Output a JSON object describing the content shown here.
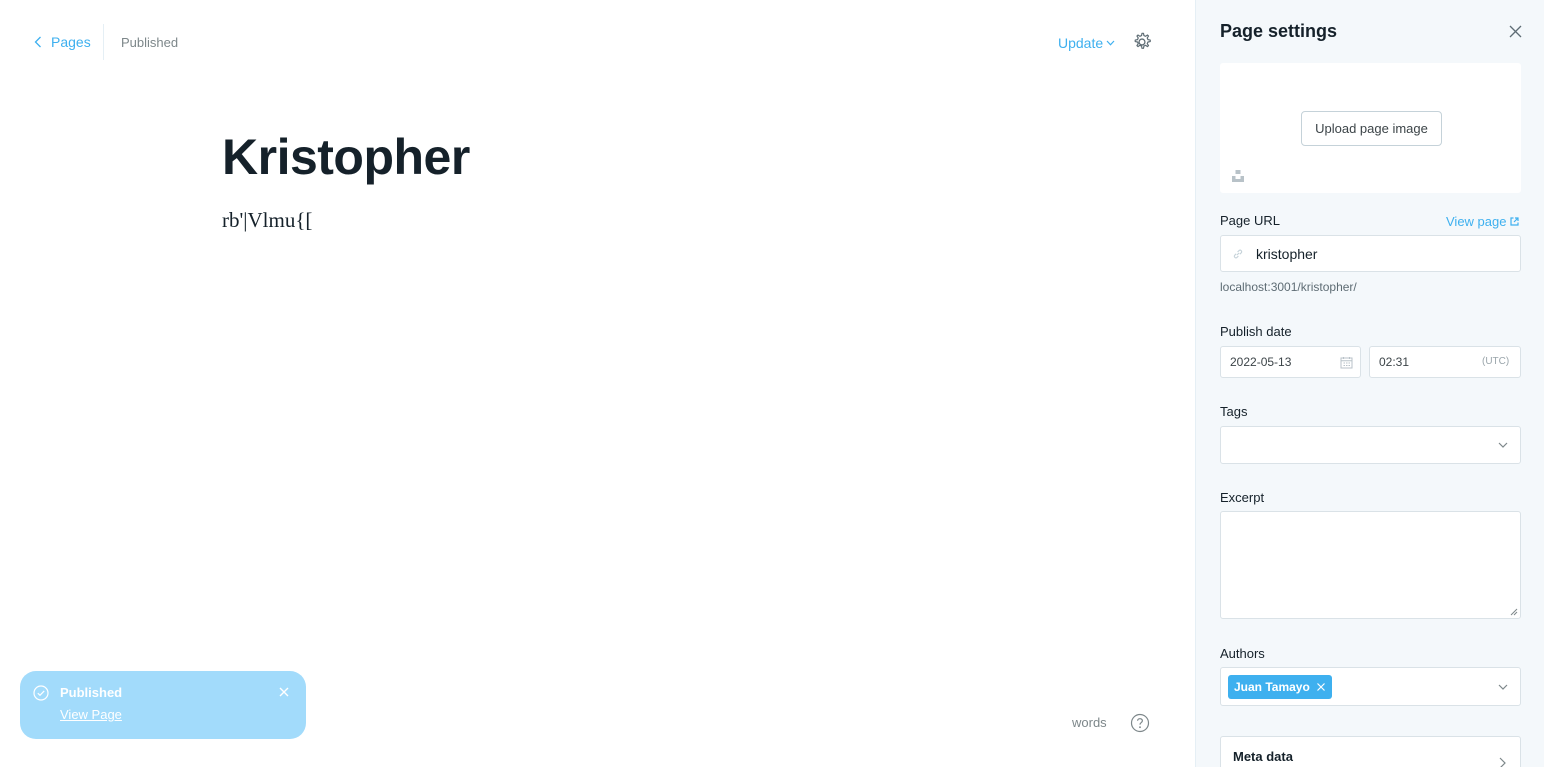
{
  "header": {
    "back_label": "Pages",
    "status": "Published",
    "update_label": "Update"
  },
  "post": {
    "title": "Kristopher",
    "body": "rb'|Vlmu{["
  },
  "footer": {
    "word_count_label": "words"
  },
  "toast": {
    "title": "Published",
    "link": "View Page"
  },
  "settings": {
    "title": "Page settings",
    "upload_label": "Upload page image",
    "url_label": "Page URL",
    "view_page_label": "View page",
    "url_value": "kristopher",
    "url_hint": "localhost:3001/kristopher/",
    "publish_date_label": "Publish date",
    "date_value": "2022-05-13",
    "time_value": "02:31",
    "timezone": "(UTC)",
    "tags_label": "Tags",
    "excerpt_label": "Excerpt",
    "authors_label": "Authors",
    "authors": [
      "Juan Tamayo"
    ],
    "meta_label": "Meta data"
  },
  "colors": {
    "accent": "#3eb0ef",
    "toast_bg": "#a2dbfb",
    "sidebar_bg": "#f4f8fb",
    "text": "#15212a",
    "muted": "#7d878a"
  },
  "icons": [
    "chevron-left-icon",
    "chevron-down-icon",
    "gear-icon",
    "help-icon",
    "check-circle-icon",
    "close-icon",
    "unsplash-icon",
    "external-link-icon",
    "link-icon",
    "calendar-icon",
    "chevron-right-icon"
  ]
}
